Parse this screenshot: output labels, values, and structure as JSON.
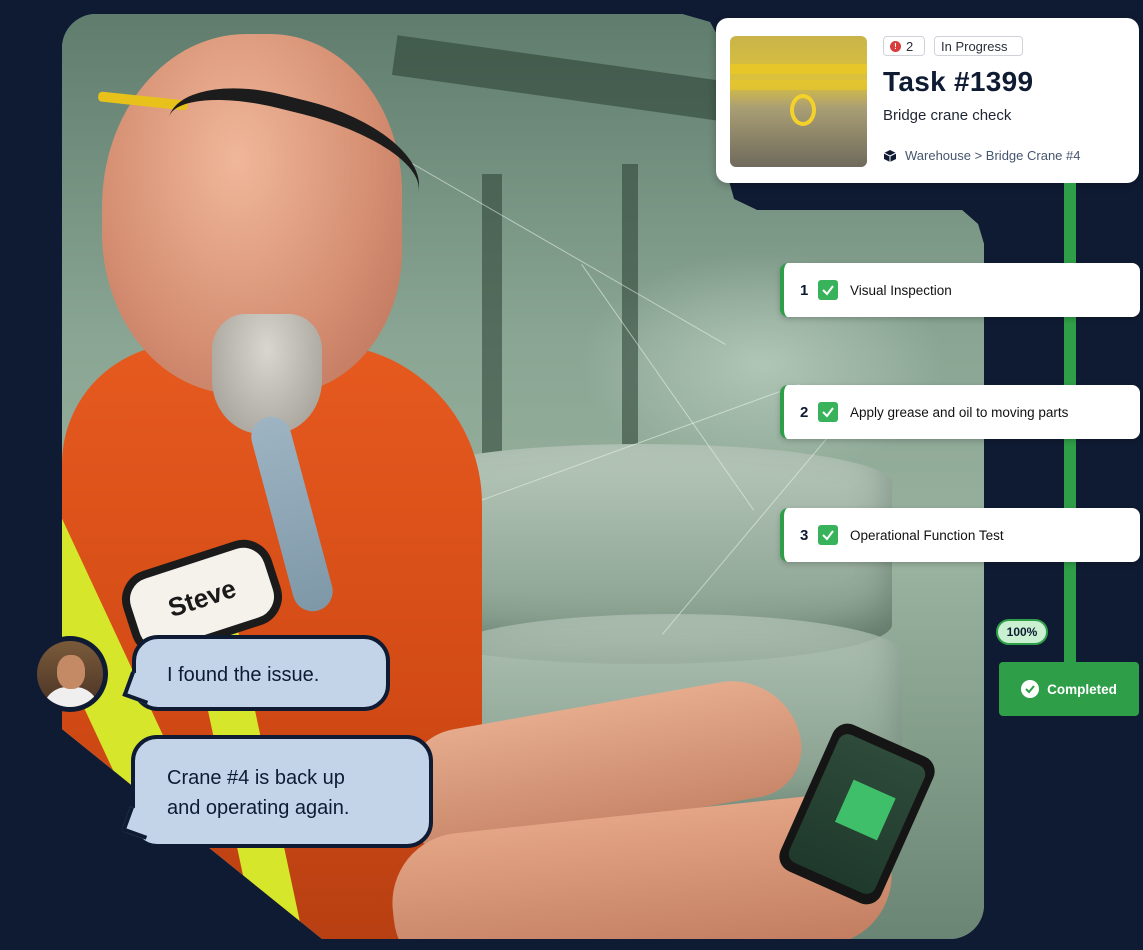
{
  "photo": {
    "name_tag": "Steve"
  },
  "task": {
    "alert_count": "2",
    "status": "In Progress",
    "title": "Task #1399",
    "subtitle": "Bridge crane check",
    "location": "Warehouse > Bridge Crane #4"
  },
  "steps": [
    {
      "number": "1",
      "label": "Visual Inspection",
      "done": true
    },
    {
      "number": "2",
      "label": "Apply grease and oil to moving parts",
      "done": true
    },
    {
      "number": "3",
      "label": "Operational Function Test",
      "done": true
    }
  ],
  "progress": {
    "percent_label": "100%",
    "value": 1.0
  },
  "completed_label": "Completed",
  "chat": {
    "messages": [
      {
        "line1": "I found the issue."
      },
      {
        "line1": "Crane #4 is back up",
        "line2": "and operating again."
      }
    ]
  },
  "colors": {
    "navy": "#0f1b33",
    "green": "#2f9e48",
    "check_green": "#38b35b",
    "bubble_blue": "#c3d3e8",
    "alert_red": "#d93a3a"
  },
  "icons": [
    "alert-icon",
    "cube-icon",
    "check-icon",
    "check-circle-icon"
  ]
}
